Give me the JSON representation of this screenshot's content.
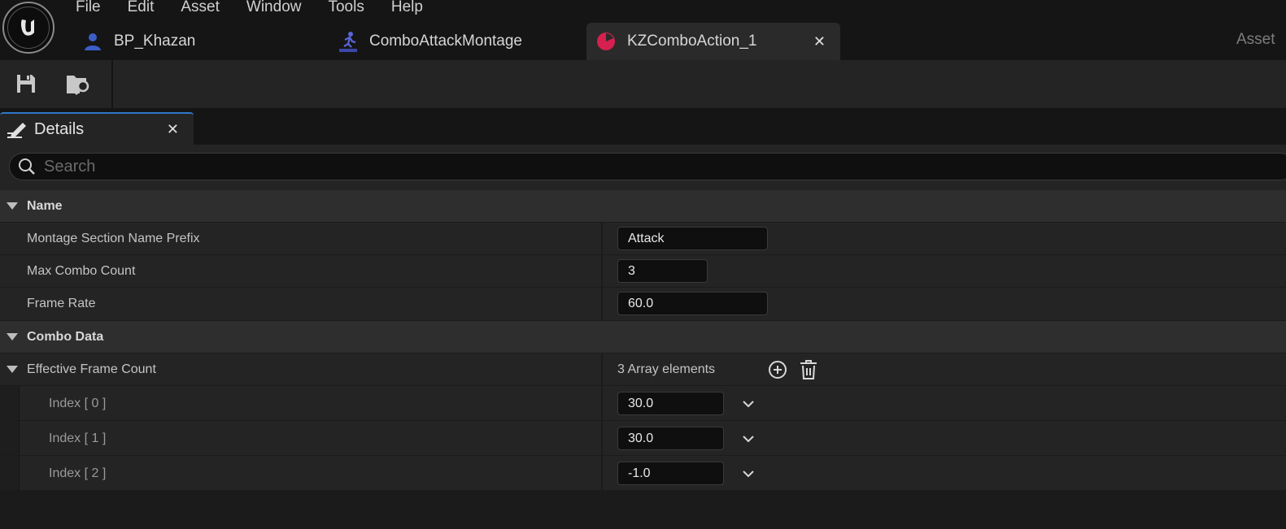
{
  "menu": [
    "File",
    "Edit",
    "Asset",
    "Window",
    "Tools",
    "Help"
  ],
  "tabs": [
    {
      "label": "BP_Khazan",
      "icon": "blueprint-character-icon"
    },
    {
      "label": "ComboAttackMontage",
      "icon": "anim-montage-icon"
    },
    {
      "label": "KZComboAction_1",
      "icon": "data-asset-icon",
      "active": true
    }
  ],
  "asset_cut_label": "Asset",
  "details": {
    "tab_label": "Details",
    "search_placeholder": "Search"
  },
  "categories": {
    "name": "Name",
    "combo_data": "Combo Data"
  },
  "properties": {
    "montage_prefix": {
      "label": "Montage Section Name Prefix",
      "value": "Attack"
    },
    "max_combo": {
      "label": "Max Combo Count",
      "value": "3"
    },
    "frame_rate": {
      "label": "Frame Rate",
      "value": "60.0"
    },
    "effective_frames": {
      "label": "Effective Frame Count",
      "summary": "3 Array elements"
    }
  },
  "array_items": [
    {
      "label": "Index [ 0 ]",
      "value": "30.0"
    },
    {
      "label": "Index [ 1 ]",
      "value": "30.0"
    },
    {
      "label": "Index [ 2 ]",
      "value": "-1.0"
    }
  ],
  "colors": {
    "accent_blue": "#2f78c8",
    "asset_red": "#d6204f"
  }
}
